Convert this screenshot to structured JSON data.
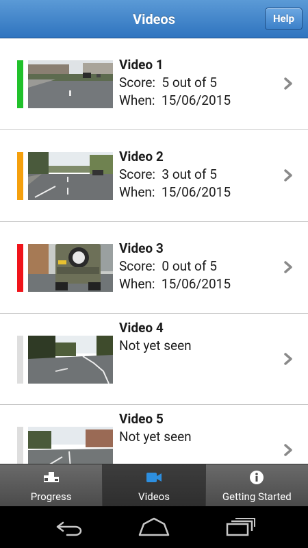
{
  "header": {
    "title": "Videos",
    "help_label": "Help"
  },
  "videos": [
    {
      "name": "Video 1",
      "score_text": "Score:  5 out of 5",
      "when_text": "When:  15/06/2015",
      "status_color": "#21c12b"
    },
    {
      "name": "Video 2",
      "score_text": "Score:  3 out of 5",
      "when_text": "When:  15/06/2015",
      "status_color": "#f5a00d"
    },
    {
      "name": "Video 3",
      "score_text": "Score:  0 out of 5",
      "when_text": "When:  15/06/2015",
      "status_color": "#f0141a"
    },
    {
      "name": "Video 4",
      "status_text": "Not yet seen",
      "status_color": "#dedede"
    },
    {
      "name": "Video 5",
      "status_text": "Not yet seen",
      "status_color": "#dedede"
    }
  ],
  "tabs": [
    {
      "label": "Progress",
      "icon": "podium-icon",
      "active": false
    },
    {
      "label": "Videos",
      "icon": "video-camera-icon",
      "active": true
    },
    {
      "label": "Getting Started",
      "icon": "info-icon",
      "active": false
    }
  ],
  "system_nav": [
    "back-icon",
    "home-icon",
    "recent-apps-icon"
  ]
}
